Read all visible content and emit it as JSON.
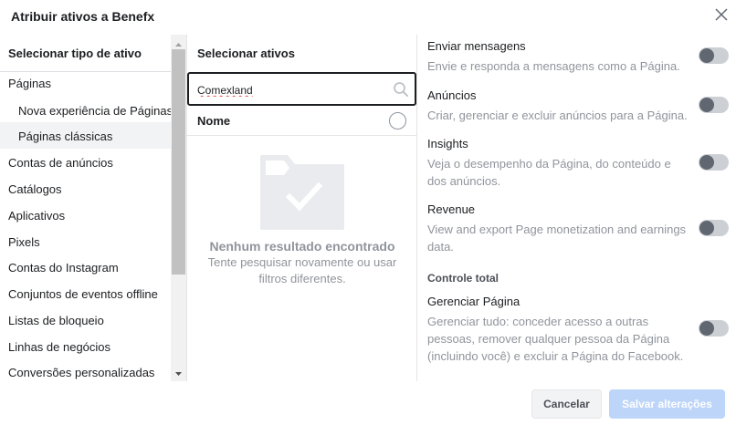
{
  "dialog": {
    "title": "Atribuir ativos a Benefx"
  },
  "asset_types": {
    "header": "Selecionar tipo de ativo",
    "items": [
      {
        "label": "Páginas",
        "sub": false
      },
      {
        "label": "Nova experiência de Páginas",
        "sub": true
      },
      {
        "label": "Páginas clássicas",
        "sub": true,
        "selected": true
      },
      {
        "label": "Contas de anúncios",
        "sub": false
      },
      {
        "label": "Catálogos",
        "sub": false
      },
      {
        "label": "Aplicativos",
        "sub": false
      },
      {
        "label": "Pixels",
        "sub": false
      },
      {
        "label": "Contas do Instagram",
        "sub": false
      },
      {
        "label": "Conjuntos de eventos offline",
        "sub": false
      },
      {
        "label": "Listas de bloqueio",
        "sub": false
      },
      {
        "label": "Linhas de negócios",
        "sub": false
      },
      {
        "label": "Conversões personalizadas",
        "sub": false
      }
    ]
  },
  "assets": {
    "header": "Selecionar ativos",
    "search": {
      "value": "Comexland",
      "placeholder": ""
    },
    "name_column": "Nome",
    "empty_state": {
      "title": "Nenhum resultado encontrado",
      "subtitle": "Tente pesquisar novamente ou usar filtros diferentes."
    }
  },
  "permissions": {
    "items": [
      {
        "title": "Enviar mensagens",
        "description": "Envie e responda a mensagens como a Página.",
        "enabled": false
      },
      {
        "title": "Anúncios",
        "description": "Criar, gerenciar e excluir anúncios para a Página.",
        "enabled": false
      },
      {
        "title": "Insights",
        "description": "Veja o desempenho da Página, do conteúdo e dos anúncios.",
        "enabled": false
      },
      {
        "title": "Revenue",
        "description": "View and export Page monetization and earnings data.",
        "enabled": false
      }
    ],
    "section_title": "Controle total",
    "full_control": {
      "title": "Gerenciar Página",
      "description": "Gerenciar tudo: conceder acesso a outras pessoas, remover qualquer pessoa da Página (incluindo você) e excluir a Página do Facebook.",
      "enabled": false
    }
  },
  "footer": {
    "cancel_label": "Cancelar",
    "save_label": "Salvar alterações"
  },
  "colors": {
    "primary_disabled": "#bdd5f8",
    "toggle_off": "#ccd0d5",
    "muted_text": "#90949c"
  }
}
